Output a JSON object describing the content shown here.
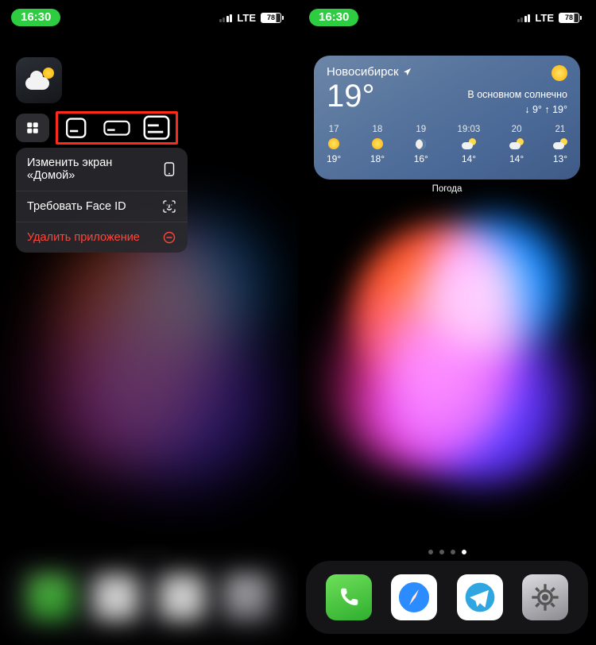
{
  "status": {
    "time": "16:30",
    "net": "LTE",
    "battery": "78"
  },
  "left": {
    "app": "Погода",
    "context_menu": {
      "edit_home": "Изменить экран «Домой»",
      "require_faceid": "Требовать Face ID",
      "delete_app": "Удалить приложение"
    }
  },
  "right": {
    "widget": {
      "city": "Новосибирск",
      "temp": "19°",
      "condition": "В основном солнечно",
      "hi_lo": "↓ 9° ↑ 19°",
      "forecast": [
        {
          "hour": "17",
          "icon": "sun",
          "temp": "19°"
        },
        {
          "hour": "18",
          "icon": "sun",
          "temp": "18°"
        },
        {
          "hour": "19",
          "icon": "moon",
          "temp": "16°"
        },
        {
          "hour": "19:03",
          "icon": "pc",
          "temp": "14°"
        },
        {
          "hour": "20",
          "icon": "pc",
          "temp": "14°"
        },
        {
          "hour": "21",
          "icon": "pc",
          "temp": "13°"
        }
      ]
    },
    "widget_label": "Погода",
    "page_dots": {
      "count": 4,
      "active": 3
    }
  },
  "dock": [
    "phone",
    "safari",
    "telegram",
    "settings"
  ]
}
